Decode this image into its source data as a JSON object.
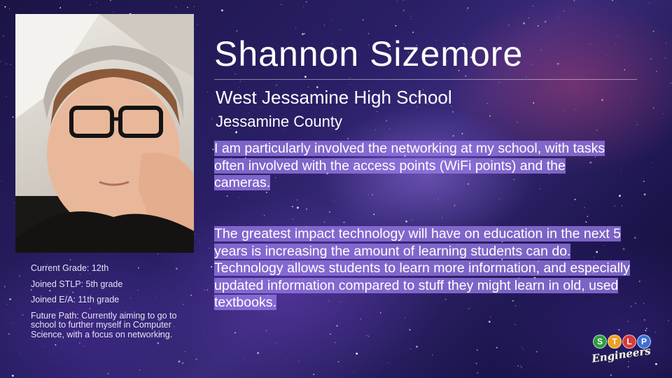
{
  "profile": {
    "name": "Shannon Sizemore",
    "school": "West Jessamine High School",
    "county": "Jessamine County"
  },
  "bio": {
    "paragraph1": "I am particularly involved the networking at my school, with tasks often involved with the access points (WiFi points) and the cameras.",
    "paragraph2": "The greatest impact technology will have on education in the next 5 years is increasing the amount of learning students can do. Technology allows students to learn more information, and especially updated information compared to stuff they might learn in old, used textbooks."
  },
  "stats": {
    "current_grade": "Current Grade: 12th",
    "joined_stlp": "Joined STLP: 5th grade",
    "joined_ea": "Joined E/A: 11th grade",
    "future_path": "Future Path: Currently aiming to go to school to further myself in Computer Science, with a focus on networking."
  },
  "logo": {
    "letters": [
      "S",
      "T",
      "L",
      "P"
    ],
    "letter_colors": [
      "#2e9c3e",
      "#f0a020",
      "#d63a3a",
      "#3d6fd1"
    ],
    "script_text": "Engineers"
  },
  "colors": {
    "highlight": "#9678e6",
    "background": "#2a1f66"
  }
}
